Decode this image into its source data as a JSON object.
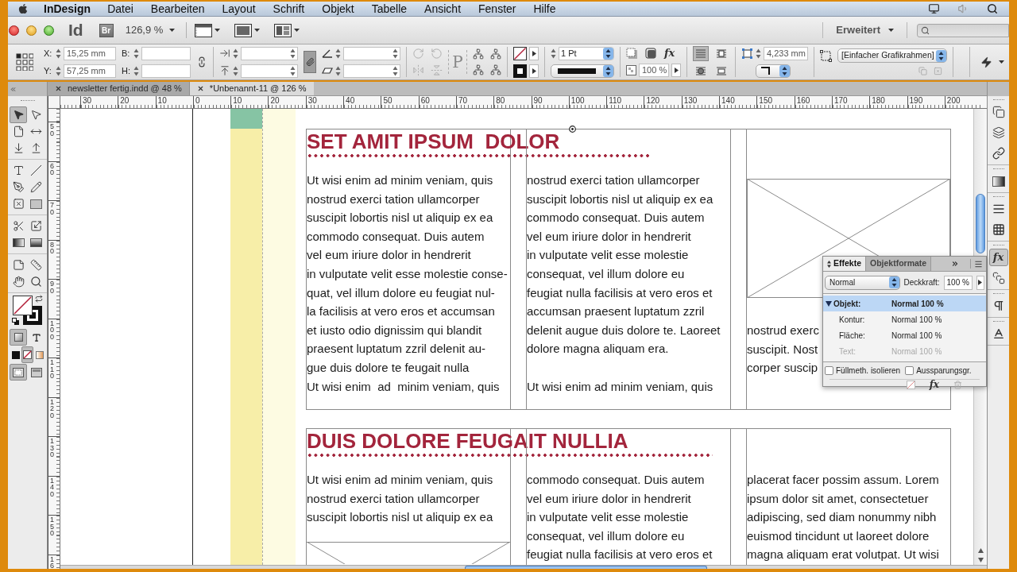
{
  "menu_bar": {
    "app": "InDesign",
    "items": [
      "Datei",
      "Bearbeiten",
      "Layout",
      "Schrift",
      "Objekt",
      "Tabelle",
      "Ansicht",
      "Fenster",
      "Hilfe"
    ]
  },
  "app_bar": {
    "logo": "Id",
    "bridge_button": "Br",
    "zoom": "126,9 %",
    "workspace": "Erweitert"
  },
  "control_panel": {
    "x_label": "X:",
    "x_value": "15,25 mm",
    "y_label": "Y:",
    "y_value": "57,25 mm",
    "w_label": "B:",
    "h_label": "H:",
    "scale_link_on": true,
    "reference_glyph": "P",
    "stroke_weight": "1 Pt",
    "fx_button": "fx",
    "opacity": "100 %",
    "wrap_options": [
      {
        "kind": "none",
        "selected": true
      },
      {
        "kind": "bounding_box",
        "selected": false
      },
      {
        "kind": "object_shape",
        "selected": false
      },
      {
        "kind": "jump",
        "selected": false
      }
    ],
    "corner_size": "4,233 mm",
    "object_style": "[Einfacher Grafikrahmen]"
  },
  "tool_groups": [
    {
      "kind": "tools",
      "tools": [
        {
          "kind": "selection",
          "selected": true
        },
        {
          "kind": "direct_selection",
          "selected": false
        },
        {
          "kind": "page",
          "selected": false
        },
        {
          "kind": "gap",
          "selected": false
        },
        {
          "kind": "collector",
          "selected": false
        },
        {
          "kind": "placer",
          "selected": false
        }
      ]
    },
    {
      "kind": "tools",
      "tools": [
        {
          "kind": "type",
          "selected": false
        },
        {
          "kind": "line",
          "selected": false
        },
        {
          "kind": "pen",
          "selected": false
        },
        {
          "kind": "pencil",
          "selected": false
        },
        {
          "kind": "frame",
          "selected": false
        },
        {
          "kind": "rectangle",
          "selected": false
        }
      ]
    },
    {
      "kind": "tools",
      "tools": [
        {
          "kind": "scissors",
          "selected": false
        },
        {
          "kind": "transform",
          "selected": false
        },
        {
          "kind": "gradient",
          "selected": false
        },
        {
          "kind": "feather",
          "selected": false
        }
      ]
    },
    {
      "kind": "tools",
      "tools": [
        {
          "kind": "note",
          "selected": false
        },
        {
          "kind": "measure",
          "selected": false
        },
        {
          "kind": "hand",
          "selected": false
        },
        {
          "kind": "zoom",
          "selected": false
        }
      ]
    },
    {
      "kind": "fill_stroke"
    },
    {
      "kind": "tools",
      "tools": [
        {
          "kind": "format_container",
          "selected": true
        },
        {
          "kind": "format_text",
          "selected": false
        }
      ]
    },
    {
      "kind": "tools",
      "tools": [
        {
          "kind": "apply_color",
          "selected": false
        },
        {
          "kind": "apply_none",
          "selected": true
        },
        {
          "kind": "apply_gradient",
          "selected": false
        }
      ]
    },
    {
      "kind": "tools",
      "tools": [
        {
          "kind": "view_normal",
          "selected": true
        },
        {
          "kind": "view_preview",
          "selected": false
        }
      ]
    }
  ],
  "document_tabs": [
    {
      "label": "newsletter fertig.indd @ 48 %",
      "selected": false
    },
    {
      "label": "*Unbenannt-11 @ 126 %",
      "selected": true
    }
  ],
  "rulers": {
    "horizontal": [
      "30",
      "20",
      "10",
      "0",
      "10",
      "20",
      "30",
      "40",
      "50",
      "60",
      "70",
      "80",
      "90",
      "100",
      "110",
      "120",
      "130",
      "140",
      "150",
      "160",
      "170",
      "180",
      "190",
      "200"
    ],
    "vertical": [
      "50",
      "60",
      "70",
      "80",
      "90",
      "100",
      "110",
      "120",
      "130",
      "140",
      "150",
      "16"
    ]
  },
  "document": {
    "sections": [
      {
        "heading": "SET AMIT IPSUM  DOLOR",
        "columns": [
          {
            "blocks": [
              {
                "kind": "text",
                "lines": [
                  "Ut wisi enim ad minim veniam, quis",
                  "nostrud exerci tation ullamcorper",
                  "suscipit lobortis nisl ut aliquip ex ea",
                  "commodo consequat. Duis autem",
                  "vel eum iriure dolor in hendrerit",
                  "in vulputate velit esse molestie conse-",
                  "quat, vel illum dolore eu feugiat nul-",
                  "la facilisis at vero eros et accumsan",
                  "et iusto odio dignissim qui blandit",
                  "praesent luptatum zzril delenit au-",
                  "gue duis dolore te feugait nulla",
                  "Ut wisi enim  ad  minim veniam, quis"
                ]
              }
            ]
          },
          {
            "blocks": [
              {
                "kind": "text",
                "lines": [
                  "nostrud exerci tation ullamcorper",
                  "suscipit lobortis nisl ut aliquip ex ea",
                  "commodo consequat. Duis autem",
                  "vel eum iriure dolor in hendrerit",
                  "in vulputate velit esse molestie",
                  "consequat, vel illum dolore eu",
                  "feugiat nulla facilisis at vero eros et",
                  "accumsan praesent luptatum zzril",
                  "delenit augue duis dolore te. Laoreet",
                  "dolore magna aliquam era."
                ]
              },
              {
                "kind": "text",
                "lines": [
                  "Ut wisi enim ad minim veniam, quis"
                ]
              }
            ]
          },
          {
            "blocks": [
              {
                "kind": "image_frame"
              },
              {
                "kind": "text",
                "lines": [
                  "nostrud exerc",
                  "suscipit. Nost",
                  "corper suscip"
                ]
              }
            ]
          }
        ]
      },
      {
        "heading": "DUIS DOLORE FEUGAIT NULLIA",
        "columns": [
          {
            "blocks": [
              {
                "kind": "text",
                "lines": [
                  "Ut wisi enim ad minim veniam, quis",
                  "nostrud exerci tation ullamcorper",
                  "suscipit lobortis nisl ut aliquip ex ea"
                ]
              },
              {
                "kind": "image_frame"
              }
            ]
          },
          {
            "blocks": [
              {
                "kind": "text",
                "lines": [
                  "commodo consequat. Duis autem",
                  "vel eum iriure dolor in hendrerit",
                  "in vulputate velit esse molestie",
                  "consequat, vel illum dolore eu",
                  "feugiat nulla facilisis at vero eros et"
                ]
              }
            ]
          },
          {
            "blocks": [
              {
                "kind": "text",
                "lines": [
                  "placerat facer possim assum. Lorem",
                  "ipsum dolor sit amet, consectetuer",
                  "adipiscing, sed diam nonummy nibh",
                  "euismod tincidunt ut laoreet dolore",
                  "magna aliquam erat volutpat. Ut wisi"
                ]
              }
            ]
          }
        ]
      }
    ]
  },
  "effects_panel": {
    "tabs": [
      {
        "label": "Effekte",
        "selected": true
      },
      {
        "label": "Objektformate",
        "selected": false
      }
    ],
    "blend_mode": "Normal",
    "opacity_label": "Deckkraft:",
    "opacity": "100 %",
    "rows": [
      {
        "kind": "group",
        "label": "Objekt:",
        "value": "Normal 100 %",
        "expanded": true,
        "selected": true,
        "disabled": false
      },
      {
        "kind": "item",
        "label": "Kontur:",
        "value": "Normal 100 %",
        "selected": false,
        "disabled": false
      },
      {
        "kind": "item",
        "label": "Fläche:",
        "value": "Normal 100 %",
        "selected": false,
        "disabled": false
      },
      {
        "kind": "item",
        "label": "Text:",
        "value": "Normal 100 %",
        "selected": false,
        "disabled": true
      }
    ],
    "options": [
      {
        "label": "Füllmeth. isolieren",
        "checked": false
      },
      {
        "label": "Aussparungsgr.",
        "checked": false
      }
    ],
    "fx_button": "fx"
  },
  "dock": [
    {
      "items": [
        {
          "kind": "pages",
          "selected": false
        },
        {
          "kind": "layers",
          "selected": false
        },
        {
          "kind": "links",
          "selected": false
        }
      ]
    },
    {
      "items": [
        {
          "kind": "gradient",
          "selected": false
        }
      ]
    },
    {
      "items": [
        {
          "kind": "stroke",
          "selected": false
        },
        {
          "kind": "swatches",
          "selected": false
        }
      ]
    },
    {
      "items": [
        {
          "kind": "effects",
          "label": "fx",
          "selected": true
        },
        {
          "kind": "object_styles",
          "selected": false
        }
      ]
    },
    {
      "items": [
        {
          "kind": "paragraph_styles",
          "selected": false
        }
      ]
    },
    {
      "items": [
        {
          "kind": "character_styles",
          "selected": false
        }
      ]
    }
  ]
}
